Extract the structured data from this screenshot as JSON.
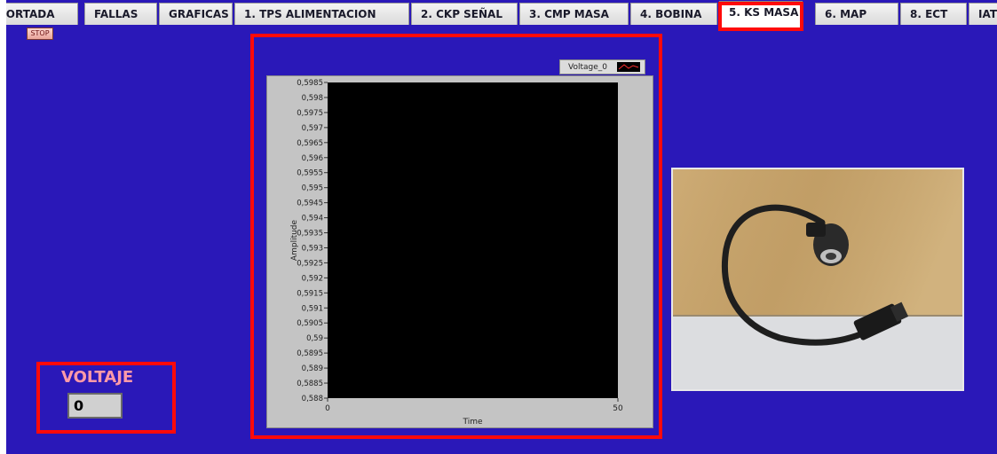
{
  "tabs": [
    {
      "label": "PORTADA"
    },
    {
      "label": "FALLAS"
    },
    {
      "label": "GRAFICAS"
    },
    {
      "label": "1. TPS ALIMENTACION"
    },
    {
      "label": "2. CKP SEÑAL"
    },
    {
      "label": "3. CMP MASA"
    },
    {
      "label": "4. BOBINA"
    },
    {
      "label": "5. KS MASA"
    },
    {
      "label": "6. MAP"
    },
    {
      "label": "8. ECT"
    },
    {
      "label": "IAT"
    }
  ],
  "active_tab": "5. KS MASA",
  "stop_button": {
    "label": "STOP"
  },
  "voltaje": {
    "label": "VOLTAJE",
    "value": "0"
  },
  "legend": {
    "label": "Voltage_0"
  },
  "photo": {
    "icon": "knock-sensor-photo"
  },
  "colors": {
    "background": "#2a18b8",
    "highlight": "#ff0a0a",
    "plot_bg": "#000000"
  },
  "chart_data": {
    "type": "line",
    "title": "",
    "xlabel": "Time",
    "ylabel": "Amplitude",
    "xlim": [
      0,
      50
    ],
    "ylim": [
      0.588,
      0.5985
    ],
    "x_tick_labels": [
      "0",
      "50"
    ],
    "y_tick_labels": [
      "0,5985",
      "0,598",
      "0,5975",
      "0,597",
      "0,5965",
      "0,596",
      "0,5955",
      "0,595",
      "0,5945",
      "0,594",
      "0,5935",
      "0,593",
      "0,5925",
      "0,592",
      "0,5915",
      "0,591",
      "0,5905",
      "0,59",
      "0,5895",
      "0,589",
      "0,5885",
      "0,588"
    ],
    "series": [
      {
        "name": "Voltage_0",
        "values": []
      }
    ],
    "legend": "top-right",
    "grid": false
  }
}
